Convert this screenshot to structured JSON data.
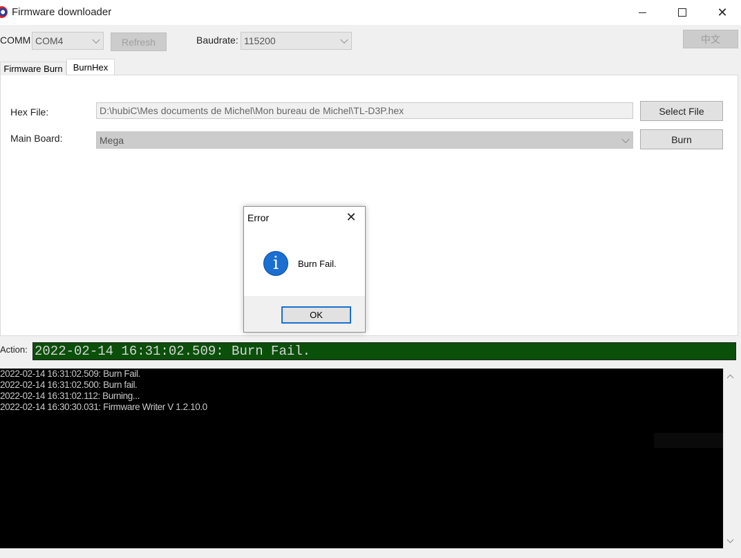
{
  "window": {
    "title": "Firmware downloader"
  },
  "toolbar": {
    "comm_label": "COMM",
    "comm_value": "COM4",
    "refresh_label": "Refresh",
    "baudrate_label": "Baudrate:",
    "baudrate_value": "115200",
    "language_label": "中文"
  },
  "tabs": [
    {
      "label": "Firmware Burn",
      "selected": false
    },
    {
      "label": "BurnHex",
      "selected": true
    }
  ],
  "burnhex": {
    "hex_file_label": "Hex File:",
    "hex_file_value": "D:\\hubiC\\Mes documents de Michel\\Mon bureau de Michel\\TL-D3P.hex",
    "select_file_label": "Select File",
    "main_board_label": "Main Board:",
    "main_board_value": "Mega",
    "burn_label": "Burn"
  },
  "dialog": {
    "title": "Error",
    "message": "Burn Fail.",
    "ok_label": "OK",
    "icon": "info-icon"
  },
  "action": {
    "label": "Action:",
    "text": "2022-02-14 16:31:02.509: Burn Fail."
  },
  "log": [
    "2022-02-14 16:31:02.509: Burn Fail.",
    "2022-02-14 16:31:02.500: Burn fail.",
    "2022-02-14 16:31:02.112: Burning...",
    "2022-02-14 16:30:30.031: Firmware Writer V 1.2.10.0"
  ],
  "colors": {
    "action_bg": "#0a4f0a",
    "dialog_accent": "#1a6fd0"
  }
}
